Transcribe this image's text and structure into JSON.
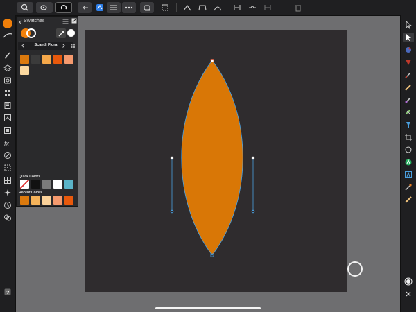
{
  "swatches_panel": {
    "title": "Swatches",
    "palette_name": "Scandi Flora",
    "palette_colors": [
      "#dc7a0d",
      "#3b3b3b",
      "#f5a84a",
      "#e8590c",
      "#f59a6e",
      "#fbd9a0"
    ],
    "quick_colors_label": "Quick Colors",
    "quick_colors": [
      "none",
      "#111111",
      "#7b7b7b",
      "#ffffff",
      "#5bb4c8"
    ],
    "recent_colors_label": "Recent Colors",
    "recent_colors": [
      "#dc7a0d",
      "#f5b35a",
      "#fbd29a",
      "#f59a6e",
      "#e8590c"
    ]
  },
  "colors": {
    "fill": "#d97706",
    "accent": "#f07f0a",
    "selection_handle": "#4aa0e0",
    "canvas": "#2f2c2e",
    "workspace": "#6e6e70"
  },
  "icons": {
    "top_toolbar": [
      "zoom-icon",
      "view-icon",
      "sync-icon",
      "back-icon",
      "persona-icon",
      "menu-icon",
      "more-icon",
      "erase-icon",
      "transform-icon",
      "sharp-node-icon",
      "smooth-node-icon",
      "curve-node-icon",
      "align-icon",
      "break-icon",
      "join-icon",
      "delete-icon"
    ],
    "left_tools": [
      "color-icon",
      "stroke-icon",
      "brush-icon",
      "layers-icon",
      "effects-icon",
      "styles-icon",
      "text-styles-icon",
      "stock-icon",
      "navigator-icon",
      "history-icon",
      "fx-icon",
      "transform-icon",
      "pages-icon",
      "glyphs-icon",
      "snapping-icon",
      "clock-icon",
      "assets-icon",
      "help-icon"
    ],
    "right_tools": [
      "move-icon",
      "node-icon",
      "contour-icon",
      "corner-icon",
      "pen-icon",
      "pencil-icon",
      "brush-icon",
      "fill-icon",
      "transparency-icon",
      "crop-icon",
      "shape-icon",
      "artistic-text-icon",
      "frame-text-icon",
      "eyedropper-icon",
      "measure-icon",
      "record-icon",
      "close-icon"
    ]
  }
}
